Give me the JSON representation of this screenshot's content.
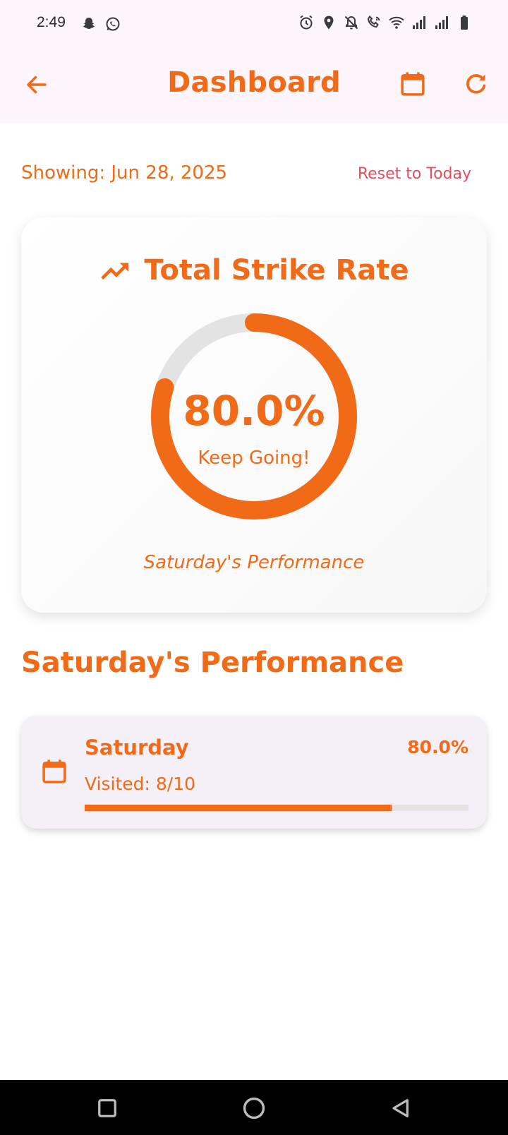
{
  "status_bar": {
    "time": "2:49",
    "left_icons": [
      "snapchat-icon",
      "whatsapp-icon"
    ],
    "right_icons": [
      "alarm-icon",
      "location-icon",
      "notifications-off-icon",
      "wifi-calling-icon",
      "wifi-icon",
      "signal-icon",
      "signal-icon",
      "battery-icon"
    ]
  },
  "app_bar": {
    "title": "Dashboard",
    "back_icon": "arrow-back-icon",
    "calendar_icon": "calendar-icon",
    "refresh_icon": "refresh-icon"
  },
  "date_filter": {
    "showing": "Showing: Jun 28, 2025",
    "reset_label": "Reset to Today"
  },
  "rate_card": {
    "icon": "trending-up-icon",
    "title": "Total Strike Rate",
    "value_text": "80.0%",
    "value_fraction": 0.8,
    "caption": "Keep Going!",
    "footer": "Saturday's Performance"
  },
  "section": {
    "heading": "Saturday's Performance"
  },
  "days": [
    {
      "name": "Saturday",
      "percent_text": "80.0%",
      "visited": "Visited: 8/10",
      "progress": 0.8,
      "icon": "calendar-icon"
    }
  ],
  "colors": {
    "accent": "#f06a17",
    "link": "#e0505e",
    "track": "#e3e3e3",
    "app_bar_bg": "#fdf5fb",
    "tile_bg": "#f5f0f7"
  },
  "nav_bar": {
    "icons": [
      "recents-square-icon",
      "home-circle-icon",
      "back-triangle-icon"
    ]
  }
}
